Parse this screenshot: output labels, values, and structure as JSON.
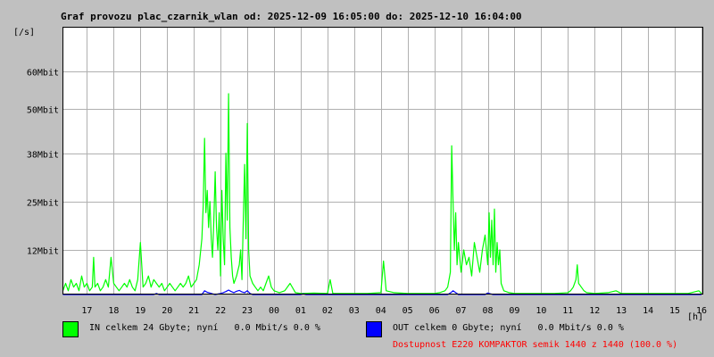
{
  "header": {
    "title": "Graf provozu plac_czarnik_wlan od: 2025-12-09 16:05:00 do: 2025-12-10 16:04:00",
    "y_unit": "[/s]",
    "x_unit": "[h]"
  },
  "legend": {
    "in": {
      "label": "IN celkem 24 Gbyte; nyní   0.0 Mbit/s 0.0 %",
      "color": "#00ff00"
    },
    "out": {
      "label": "OUT celkem 0 Gbyte; nyní   0.0 Mbit/s 0.0 %",
      "color": "#0000ff"
    },
    "availability": {
      "label": "Dostupnost E220 KOMPAKTOR semik 1440 z 1440 (100.0 %)",
      "color": "#ff0000"
    }
  },
  "chart_data": {
    "type": "area",
    "title": "Graf provozu plac_czarnik_wlan od: 2025-12-09 16:05:00 do: 2025-12-10 16:04:00",
    "xlabel": "[h]",
    "ylabel": "[/s]",
    "xlim": [
      "2025-12-09 16:05",
      "2025-12-10 16:04"
    ],
    "ylim": [
      0,
      72
    ],
    "y_ticks": [
      12,
      25,
      38,
      50,
      60
    ],
    "y_tick_labels": [
      "12Mbit",
      "25Mbit",
      "38Mbit",
      "50Mbit",
      "60Mbit"
    ],
    "x_tick_labels": [
      "17",
      "18",
      "19",
      "20",
      "21",
      "22",
      "23",
      "00",
      "01",
      "02",
      "03",
      "04",
      "05",
      "06",
      "07",
      "08",
      "09",
      "10",
      "11",
      "12",
      "13",
      "14",
      "15",
      "16"
    ],
    "grid": true,
    "series": [
      {
        "name": "IN",
        "color": "#00ff00",
        "points": [
          [
            16.1,
            1
          ],
          [
            16.2,
            3
          ],
          [
            16.3,
            1
          ],
          [
            16.4,
            4
          ],
          [
            16.5,
            2
          ],
          [
            16.6,
            3
          ],
          [
            16.7,
            1
          ],
          [
            16.8,
            5
          ],
          [
            16.9,
            2
          ],
          [
            17.0,
            3
          ],
          [
            17.1,
            1
          ],
          [
            17.2,
            2
          ],
          [
            17.25,
            10
          ],
          [
            17.3,
            2
          ],
          [
            17.4,
            3
          ],
          [
            17.5,
            1
          ],
          [
            17.6,
            2
          ],
          [
            17.7,
            4
          ],
          [
            17.8,
            2
          ],
          [
            17.9,
            10
          ],
          [
            18.0,
            3
          ],
          [
            18.1,
            2
          ],
          [
            18.2,
            1
          ],
          [
            18.3,
            2
          ],
          [
            18.4,
            3
          ],
          [
            18.5,
            2
          ],
          [
            18.6,
            4
          ],
          [
            18.7,
            2
          ],
          [
            18.8,
            1
          ],
          [
            18.9,
            4
          ],
          [
            19.0,
            14
          ],
          [
            19.1,
            2
          ],
          [
            19.2,
            3
          ],
          [
            19.3,
            5
          ],
          [
            19.4,
            2
          ],
          [
            19.5,
            4
          ],
          [
            19.6,
            3
          ],
          [
            19.7,
            2
          ],
          [
            19.8,
            3
          ],
          [
            19.9,
            1
          ],
          [
            20.0,
            2
          ],
          [
            20.1,
            3
          ],
          [
            20.2,
            2
          ],
          [
            20.3,
            1
          ],
          [
            20.4,
            2
          ],
          [
            20.5,
            3
          ],
          [
            20.6,
            2
          ],
          [
            20.7,
            3
          ],
          [
            20.8,
            5
          ],
          [
            20.9,
            2
          ],
          [
            21.0,
            3
          ],
          [
            21.1,
            4
          ],
          [
            21.2,
            8
          ],
          [
            21.3,
            15
          ],
          [
            21.35,
            24
          ],
          [
            21.4,
            42
          ],
          [
            21.45,
            22
          ],
          [
            21.5,
            28
          ],
          [
            21.55,
            18
          ],
          [
            21.6,
            25
          ],
          [
            21.65,
            15
          ],
          [
            21.7,
            10
          ],
          [
            21.75,
            20
          ],
          [
            21.8,
            33
          ],
          [
            21.85,
            18
          ],
          [
            21.9,
            12
          ],
          [
            21.95,
            22
          ],
          [
            22.0,
            5
          ],
          [
            22.05,
            28
          ],
          [
            22.1,
            15
          ],
          [
            22.15,
            8
          ],
          [
            22.2,
            38
          ],
          [
            22.25,
            20
          ],
          [
            22.3,
            54
          ],
          [
            22.35,
            18
          ],
          [
            22.4,
            10
          ],
          [
            22.45,
            5
          ],
          [
            22.5,
            3
          ],
          [
            22.6,
            5
          ],
          [
            22.7,
            8
          ],
          [
            22.75,
            12
          ],
          [
            22.8,
            4
          ],
          [
            22.85,
            20
          ],
          [
            22.9,
            35
          ],
          [
            22.95,
            15
          ],
          [
            23.0,
            46
          ],
          [
            23.05,
            12
          ],
          [
            23.1,
            5
          ],
          [
            23.2,
            3
          ],
          [
            23.3,
            2
          ],
          [
            23.4,
            1
          ],
          [
            23.5,
            2
          ],
          [
            23.6,
            1
          ],
          [
            23.7,
            3
          ],
          [
            23.8,
            5
          ],
          [
            23.9,
            2
          ],
          [
            24.0,
            1
          ],
          [
            24.2,
            0.5
          ],
          [
            24.4,
            1
          ],
          [
            24.6,
            3
          ],
          [
            24.8,
            0.5
          ],
          [
            25.0,
            0.3
          ],
          [
            25.5,
            0.4
          ],
          [
            26.0,
            0.3
          ],
          [
            26.1,
            4
          ],
          [
            26.2,
            0.3
          ],
          [
            26.5,
            0.3
          ],
          [
            27.0,
            0.3
          ],
          [
            27.5,
            0.3
          ],
          [
            28.0,
            0.5
          ],
          [
            28.1,
            9
          ],
          [
            28.2,
            1
          ],
          [
            28.5,
            0.5
          ],
          [
            29.0,
            0.3
          ],
          [
            29.5,
            0.3
          ],
          [
            30.0,
            0.3
          ],
          [
            30.2,
            0.5
          ],
          [
            30.4,
            1
          ],
          [
            30.5,
            2
          ],
          [
            30.6,
            6
          ],
          [
            30.65,
            40
          ],
          [
            30.7,
            25
          ],
          [
            30.75,
            12
          ],
          [
            30.8,
            22
          ],
          [
            30.85,
            8
          ],
          [
            30.9,
            14
          ],
          [
            31.0,
            6
          ],
          [
            31.1,
            12
          ],
          [
            31.2,
            8
          ],
          [
            31.3,
            10
          ],
          [
            31.4,
            5
          ],
          [
            31.5,
            14
          ],
          [
            31.6,
            10
          ],
          [
            31.7,
            6
          ],
          [
            31.8,
            12
          ],
          [
            31.9,
            16
          ],
          [
            32.0,
            8
          ],
          [
            32.05,
            22
          ],
          [
            32.1,
            10
          ],
          [
            32.15,
            20
          ],
          [
            32.2,
            8
          ],
          [
            32.25,
            23
          ],
          [
            32.3,
            6
          ],
          [
            32.35,
            14
          ],
          [
            32.4,
            8
          ],
          [
            32.45,
            12
          ],
          [
            32.5,
            3
          ],
          [
            32.6,
            1
          ],
          [
            32.8,
            0.5
          ],
          [
            33.0,
            0.3
          ],
          [
            33.5,
            0.3
          ],
          [
            34.0,
            0.3
          ],
          [
            34.5,
            0.3
          ],
          [
            35.0,
            0.5
          ],
          [
            35.1,
            1
          ],
          [
            35.2,
            2
          ],
          [
            35.3,
            4
          ],
          [
            35.35,
            8
          ],
          [
            35.4,
            3
          ],
          [
            35.5,
            2
          ],
          [
            35.6,
            1
          ],
          [
            35.7,
            0.5
          ],
          [
            36.0,
            0.3
          ],
          [
            36.5,
            0.5
          ],
          [
            36.8,
            1
          ],
          [
            37.0,
            0.3
          ],
          [
            37.5,
            0.3
          ],
          [
            38.0,
            0.3
          ],
          [
            38.5,
            0.3
          ],
          [
            39.0,
            0.3
          ],
          [
            39.5,
            0.3
          ],
          [
            39.9,
            1
          ],
          [
            40.0,
            0.3
          ]
        ]
      },
      {
        "name": "OUT",
        "color": "#0000ff",
        "points": [
          [
            16.1,
            0
          ],
          [
            19.5,
            0
          ],
          [
            19.6,
            0.3
          ],
          [
            19.7,
            0
          ],
          [
            21.3,
            0
          ],
          [
            21.4,
            1
          ],
          [
            21.5,
            0.6
          ],
          [
            21.6,
            0.4
          ],
          [
            21.7,
            0.2
          ],
          [
            21.8,
            0
          ],
          [
            22.0,
            0.3
          ],
          [
            22.1,
            0.5
          ],
          [
            22.2,
            0.8
          ],
          [
            22.3,
            1.2
          ],
          [
            22.4,
            0.8
          ],
          [
            22.5,
            0.5
          ],
          [
            22.6,
            0.9
          ],
          [
            22.7,
            1.1
          ],
          [
            22.8,
            0.7
          ],
          [
            22.9,
            0.5
          ],
          [
            23.0,
            1
          ],
          [
            23.1,
            0.3
          ],
          [
            23.2,
            0
          ],
          [
            25.0,
            0
          ],
          [
            25.1,
            0.2
          ],
          [
            25.2,
            0
          ],
          [
            30.5,
            0
          ],
          [
            30.6,
            0.4
          ],
          [
            30.7,
            1
          ],
          [
            30.8,
            0.5
          ],
          [
            30.9,
            0
          ],
          [
            31.9,
            0
          ],
          [
            32.0,
            0.4
          ],
          [
            32.1,
            0.2
          ],
          [
            32.2,
            0
          ],
          [
            40.0,
            0
          ]
        ]
      }
    ]
  }
}
